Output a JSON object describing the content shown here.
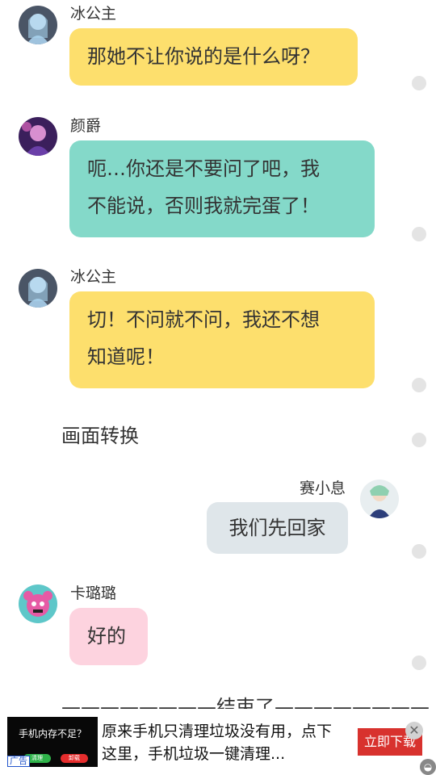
{
  "messages": [
    {
      "sender": "冰公主",
      "text": "那她不让你说的是什么呀？"
    },
    {
      "sender": "颜爵",
      "lines": [
        "呃…你还是不要问了吧，我",
        "不能说，否则我就完蛋了！"
      ]
    },
    {
      "sender": "冰公主",
      "lines": [
        "切！不问就不问，我还不想",
        "知道呢！"
      ]
    },
    {
      "sender": "赛小息",
      "text": "我们先回家"
    },
    {
      "sender": "卡璐璐",
      "text": "好的"
    }
  ],
  "narration": {
    "scene_change": "画面转换",
    "end": "————————结束了————————"
  },
  "ad": {
    "image_title": "手机内存不足？",
    "image_btn1": "清理",
    "image_btn2": "卸载",
    "text": "原来手机只清理垃圾没有用，点下这里，手机垃圾一键清理...",
    "cta": "立即下载",
    "close": "✕",
    "tag": "广告"
  },
  "colors": {
    "yellow_bubble": "#fddf6d",
    "teal_bubble": "#84d9c9",
    "blue_bubble": "#dfe6ea",
    "pink_bubble": "#fdd3df",
    "ad_button": "#d8322e"
  }
}
